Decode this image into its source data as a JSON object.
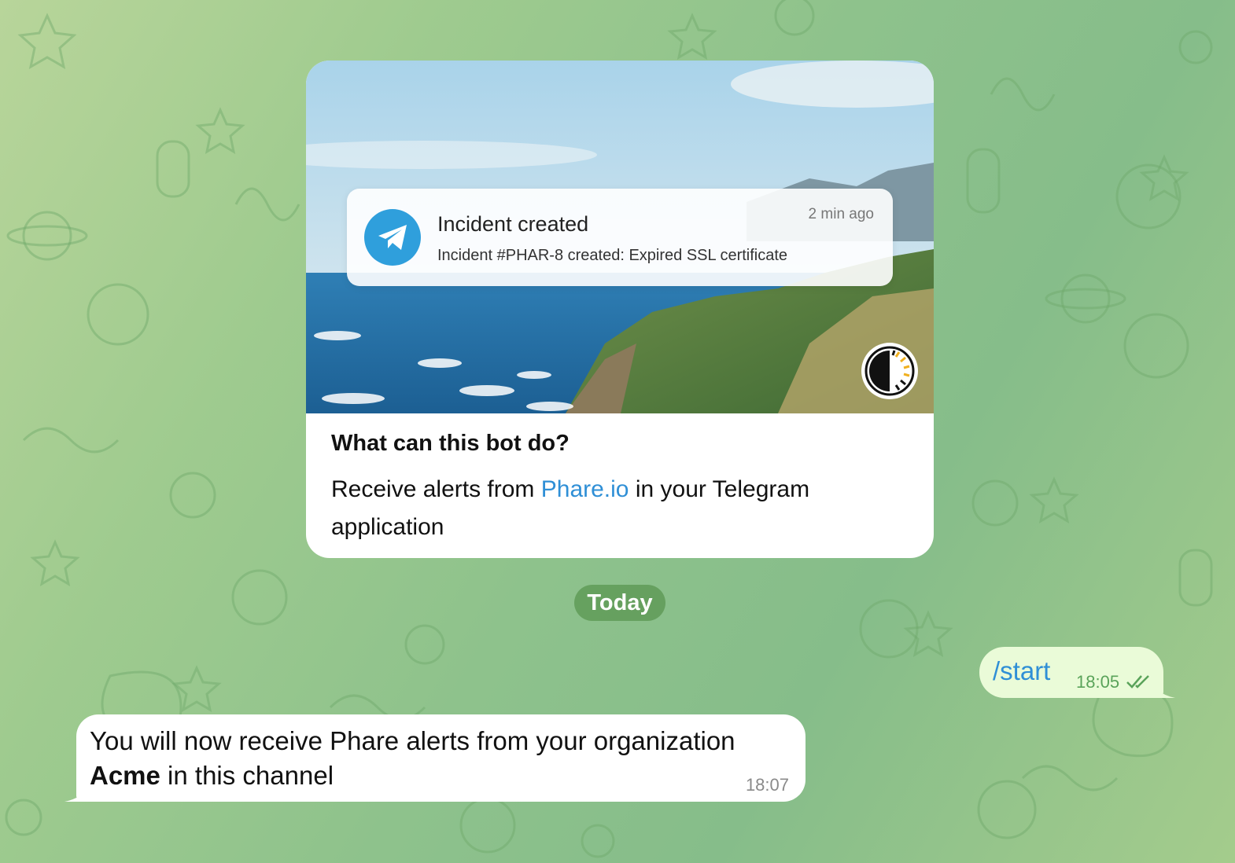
{
  "bot_intro": {
    "notification": {
      "title": "Incident created",
      "body": "Incident #PHAR-8 created: Expired SSL certificate",
      "time": "2 min ago",
      "icon": "telegram-plane-icon"
    },
    "brand_icon": "phare-logo-icon",
    "heading": "What can this bot do?",
    "description_before_link": "Receive alerts from ",
    "link_text": "Phare.io",
    "description_after_link": " in your Telegram application"
  },
  "date_separator": "Today",
  "messages": [
    {
      "direction": "outgoing",
      "text": "/start",
      "time": "18:05",
      "status_icon": "double-check-icon"
    },
    {
      "direction": "incoming",
      "text_before_bold": "You will now receive Phare alerts from your organization ",
      "bold": "Acme",
      "text_after_bold": " in this channel",
      "time": "18:07"
    }
  ],
  "colors": {
    "link": "#2f8fd6",
    "outgoing_bubble": "#eafbd8",
    "incoming_bubble": "#ffffff",
    "telegram_blue": "#2f9fdc",
    "read_status": "#5aa35a"
  }
}
